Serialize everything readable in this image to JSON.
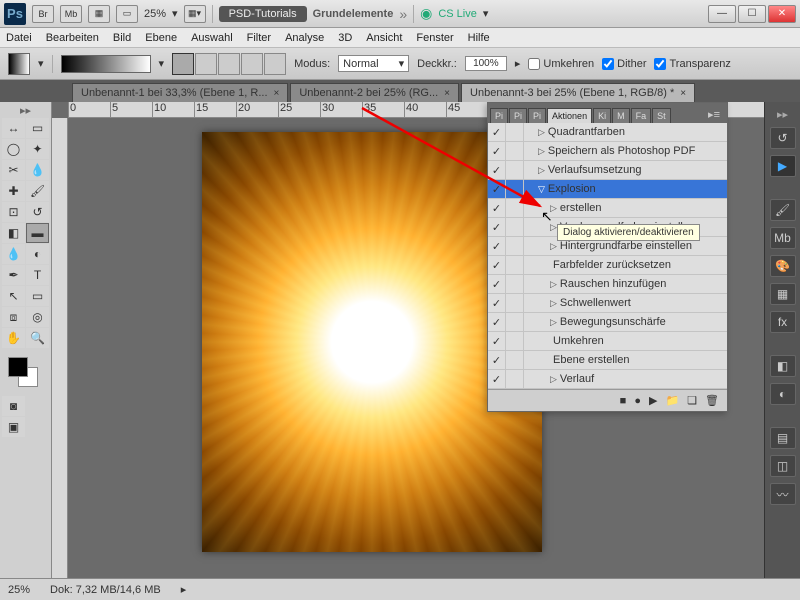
{
  "title": {
    "workspace": "PSD-Tutorials",
    "doc": "Grundelemente",
    "cslive": "CS Live"
  },
  "menu": [
    "Datei",
    "Bearbeiten",
    "Bild",
    "Ebene",
    "Auswahl",
    "Filter",
    "Analyse",
    "3D",
    "Ansicht",
    "Fenster",
    "Hilfe"
  ],
  "titlebar": {
    "br": "Br",
    "mb": "Mb",
    "zoom": "25%"
  },
  "optbar": {
    "modus_label": "Modus:",
    "modus_value": "Normal",
    "deck_label": "Deckkr.:",
    "deck_value": "100%",
    "umkehren": "Umkehren",
    "dither": "Dither",
    "transparenz": "Transparenz"
  },
  "tabs": [
    {
      "label": "Unbenannt-1 bei 33,3% (Ebene 1, R...",
      "active": false
    },
    {
      "label": "Unbenannt-2 bei 25% (RG...",
      "active": false
    },
    {
      "label": "Unbenannt-3 bei 25% (Ebene 1, RGB/8) *",
      "active": true
    }
  ],
  "ruler": [
    "0",
    "5",
    "10",
    "15",
    "20",
    "25",
    "30",
    "35",
    "40",
    "45"
  ],
  "panel": {
    "tabs": [
      "Pi",
      "Pi",
      "Pi",
      "Aktionen",
      "Ki",
      "M",
      "Fa",
      "St"
    ],
    "active": "Aktionen"
  },
  "actions": [
    {
      "chk": true,
      "dlg": false,
      "indent": 1,
      "expand": "▷",
      "label": "Quadrantfarben",
      "sel": false
    },
    {
      "chk": true,
      "dlg": false,
      "indent": 1,
      "expand": "▷",
      "label": "Speichern als Photoshop PDF",
      "sel": false
    },
    {
      "chk": true,
      "dlg": false,
      "indent": 1,
      "expand": "▷",
      "label": "Verlaufsumsetzung",
      "sel": false
    },
    {
      "chk": true,
      "dlg": false,
      "indent": 1,
      "expand": "▽",
      "label": "Explosion",
      "sel": true
    },
    {
      "chk": true,
      "dlg": false,
      "indent": 2,
      "expand": "▷",
      "label": "erstellen",
      "sel": false
    },
    {
      "chk": true,
      "dlg": false,
      "indent": 2,
      "expand": "▷",
      "label": "Vordergrundfarbe einstell...",
      "sel": false
    },
    {
      "chk": true,
      "dlg": false,
      "indent": 2,
      "expand": "▷",
      "label": "Hintergrundfarbe einstellen",
      "sel": false
    },
    {
      "chk": true,
      "dlg": false,
      "indent": 2,
      "expand": "",
      "label": "Farbfelder zurücksetzen",
      "sel": false
    },
    {
      "chk": true,
      "dlg": false,
      "indent": 2,
      "expand": "▷",
      "label": "Rauschen hinzufügen",
      "sel": false
    },
    {
      "chk": true,
      "dlg": false,
      "indent": 2,
      "expand": "▷",
      "label": "Schwellenwert",
      "sel": false
    },
    {
      "chk": true,
      "dlg": false,
      "indent": 2,
      "expand": "▷",
      "label": "Bewegungsunschärfe",
      "sel": false
    },
    {
      "chk": true,
      "dlg": false,
      "indent": 2,
      "expand": "",
      "label": "Umkehren",
      "sel": false
    },
    {
      "chk": true,
      "dlg": false,
      "indent": 2,
      "expand": "",
      "label": "Ebene erstellen",
      "sel": false
    },
    {
      "chk": true,
      "dlg": false,
      "indent": 2,
      "expand": "▷",
      "label": "Verlauf",
      "sel": false
    }
  ],
  "tooltip": "Dialog aktivieren/deaktivieren",
  "status": {
    "zoom": "25%",
    "dok": "Dok: 7,32 MB/14,6 MB"
  }
}
